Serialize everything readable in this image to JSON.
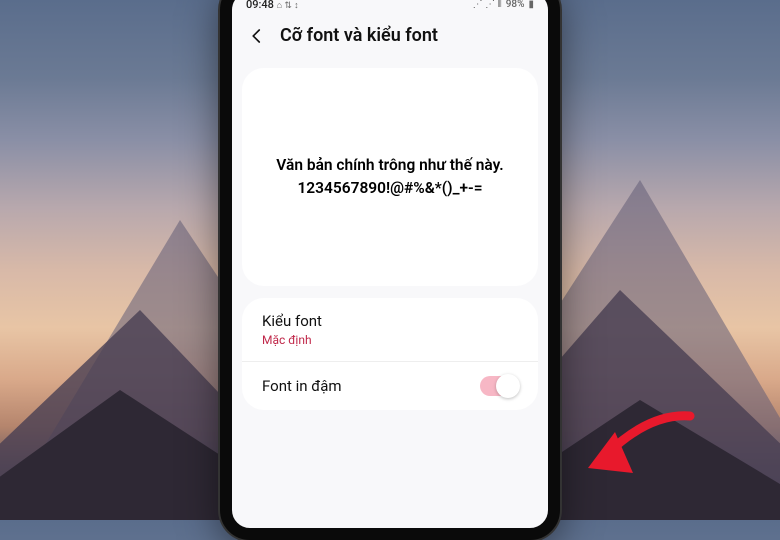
{
  "statusbar": {
    "time": "09:48",
    "icons_desc": "⌵ ⎋ ↕",
    "battery": "98%"
  },
  "header": {
    "title": "Cỡ font và kiểu font"
  },
  "preview": {
    "line1": "Văn bản chính trông như thế này.",
    "line2": "1234567890!@#%&*()_+-="
  },
  "settings": {
    "font_style": {
      "label": "Kiểu font",
      "value": "Mặc định"
    },
    "bold": {
      "label": "Font in đậm",
      "enabled": true
    }
  }
}
